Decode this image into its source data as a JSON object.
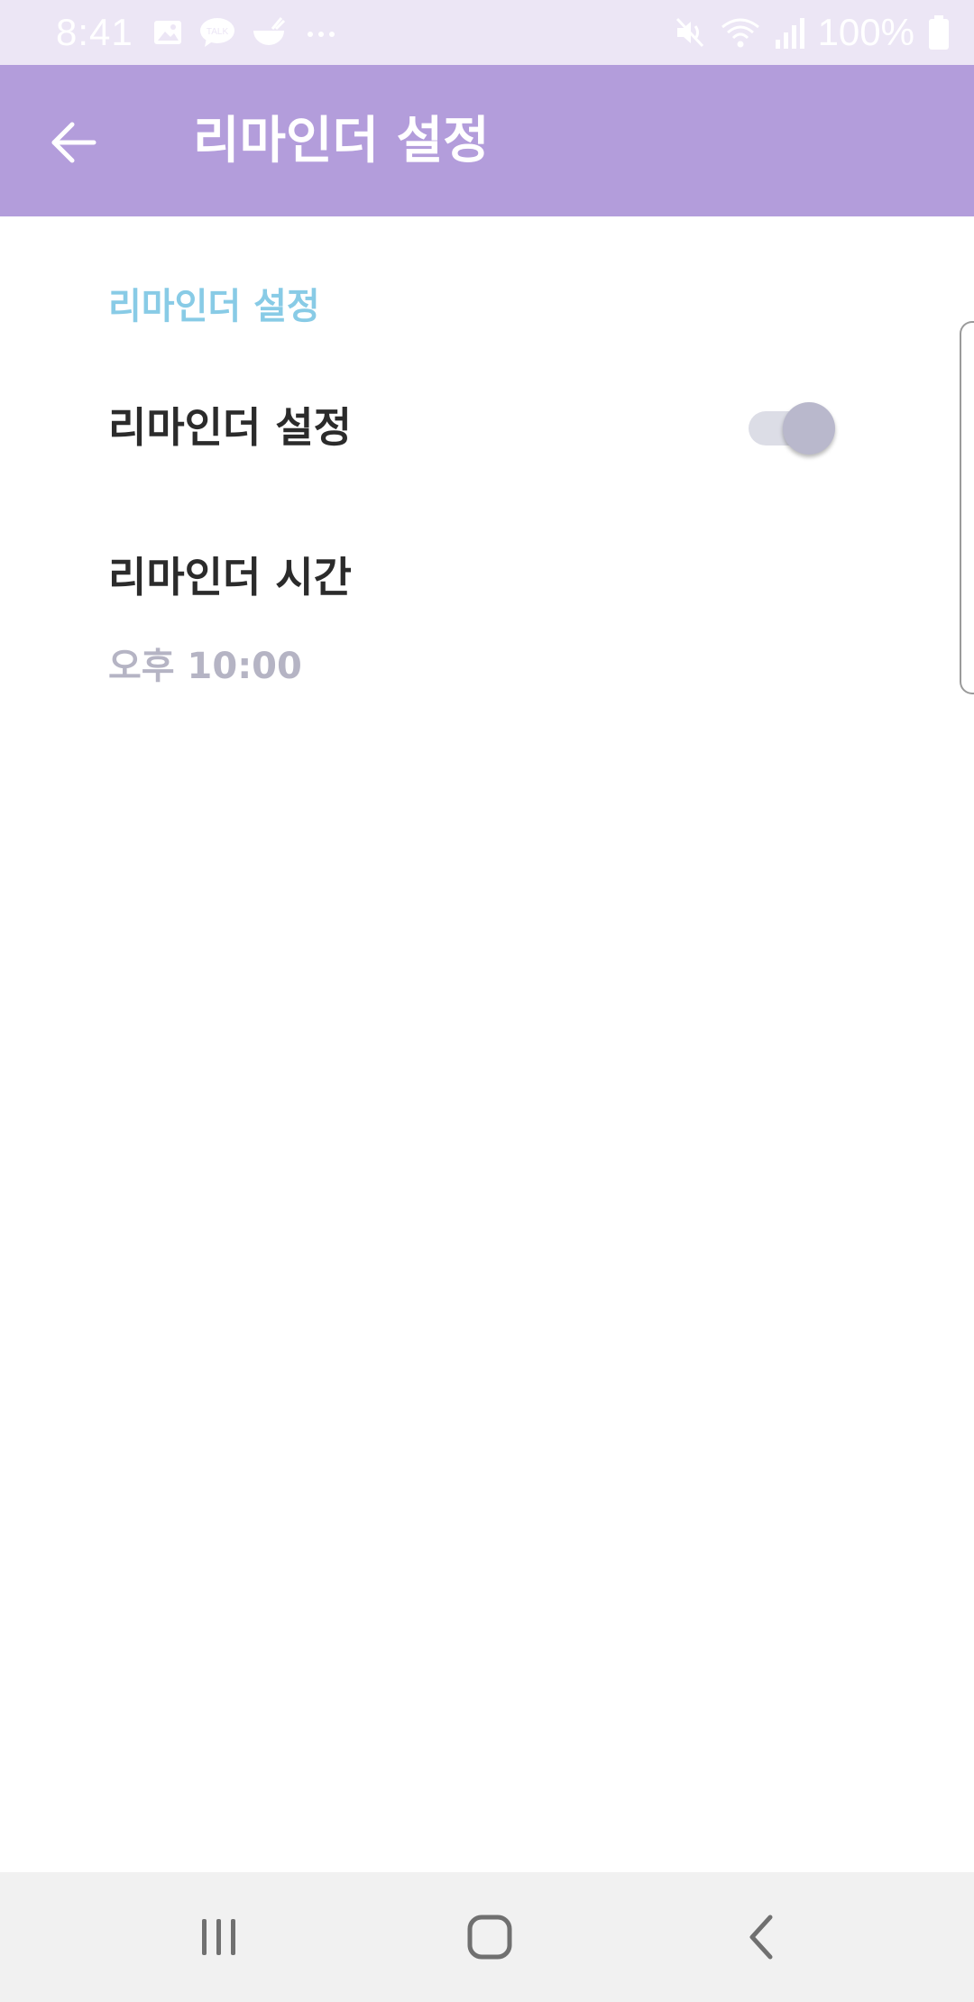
{
  "status_bar": {
    "time": "8:41",
    "battery": "100%",
    "icons_left": [
      "image-icon",
      "talk-icon",
      "bowl-icon",
      "more-dots-icon"
    ],
    "icons_right": [
      "mute-icon",
      "wifi-icon",
      "signal-icon",
      "battery-icon"
    ],
    "talk_badge": "TALK"
  },
  "app_bar": {
    "title": "리마인더 설정",
    "background": "#b39ddb",
    "back_icon": "arrow-left-icon"
  },
  "settings": {
    "section_header": "리마인더 설정",
    "section_header_color": "#88cbe6",
    "reminder_toggle": {
      "label": "리마인더 설정",
      "enabled": true
    },
    "reminder_time": {
      "label": "리마인더 시간",
      "value": "오후 10:00"
    }
  },
  "nav_bar": {
    "buttons": [
      "recents-icon",
      "home-icon",
      "back-icon"
    ]
  }
}
